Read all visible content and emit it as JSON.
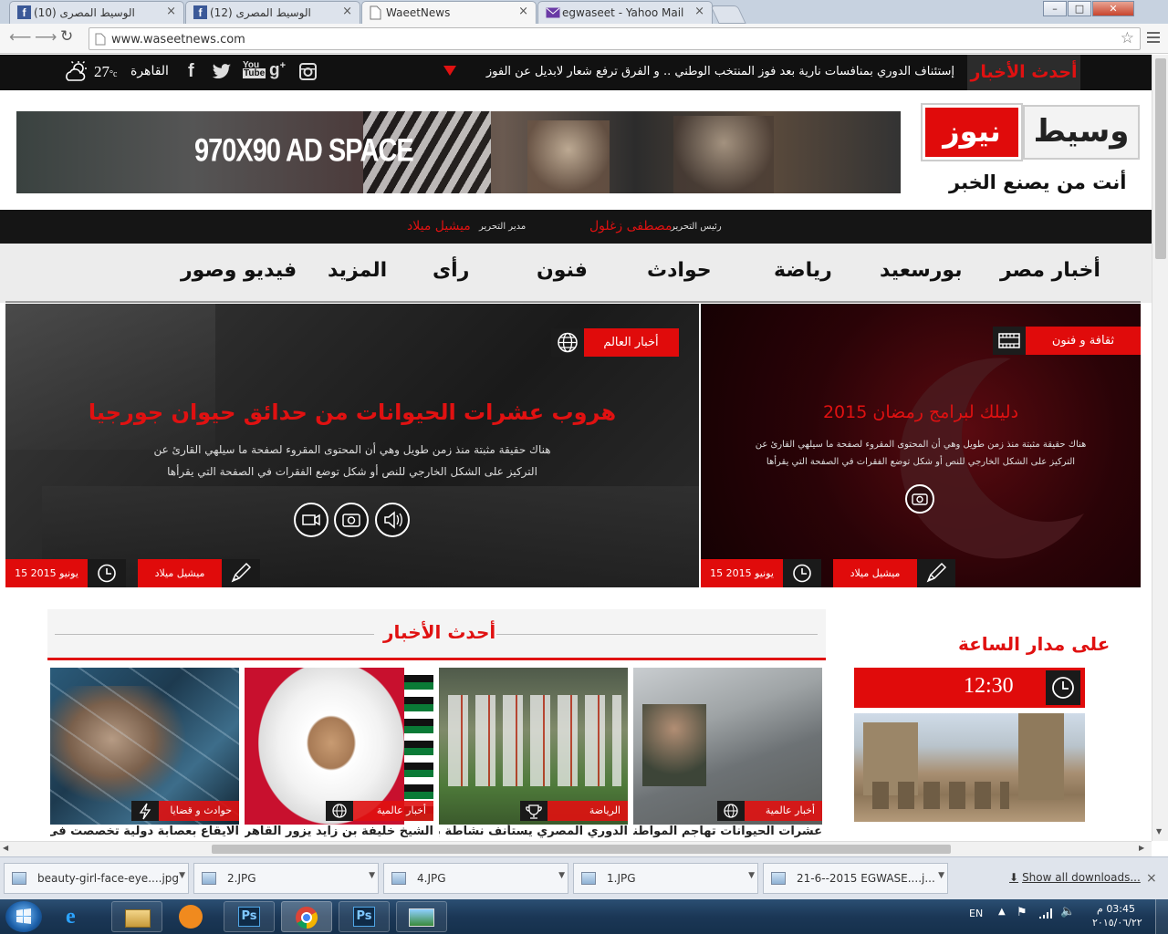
{
  "browser": {
    "tabs": [
      {
        "label": "(10) الوسيط المصرى",
        "close": "×"
      },
      {
        "label": "(12) الوسيط المصرى",
        "close": "×"
      },
      {
        "label": "WaeetNews",
        "close": "×"
      },
      {
        "label": "egwaseet - Yahoo Mail",
        "close": "×"
      }
    ],
    "url": "www.waseetnews.com",
    "window_controls": {
      "min": "–",
      "max": "□",
      "close": "✕"
    }
  },
  "topbar": {
    "latest_label": "أحدث الأخبار",
    "ticker": "إستئناف الدوري بمنافسات نارية بعد فوز المنتخب الوطني .. و الفرق ترفع شعار لابديل عن الفوز",
    "city": "القاهرة",
    "temperature": "27",
    "temp_unit": "°c",
    "social": [
      "f",
      "t",
      "You Tube",
      "g+",
      "instagram"
    ]
  },
  "ad": {
    "text": "970X90 AD SPACE"
  },
  "logo": {
    "word1": "وسيط",
    "word2": "نيوز",
    "tagline": "أنت من يصنع الخبر"
  },
  "staff": {
    "editor_in_chief_label": "رئيس التحرير",
    "editor_in_chief": "مصطفى زغلول",
    "managing_editor_label": "مدير التحرير",
    "managing_editor": "ميشيل ميلاد"
  },
  "menu": [
    "أخبار مصر",
    "بورسعيد",
    "رياضة",
    "حوادث",
    "فنون",
    "رأى",
    "المزيد",
    "فيديو وصور"
  ],
  "hero_left": {
    "category": "أخبار العالم",
    "title": "هروب عشرات الحيوانات من حدائق حيوان جورجيا",
    "text_line1": "هناك حقيقة مثبتة منذ زمن طويل وهي أن المحتوى المقروء لصفحة ما سيلهي القارئ عن",
    "text_line2": "التركيز على الشكل الخارجي للنص أو شكل توضع الفقرات في الصفحة التي يقرأها",
    "author": "ميشيل ميلاد",
    "date": "15 يونيو 2015"
  },
  "hero_right": {
    "category": "ثقافة و فنون",
    "title": "دليلك لبرامج رمضان 2015",
    "text_line1": "هناك حقيقة مثبتة منذ زمن طويل وهي أن المحتوى المقروء لصفحة ما سيلهي القارئ عن",
    "text_line2": "التركيز على الشكل الخارجي للنص أو شكل توضع الفقرات في الصفحة التي يقرأها",
    "author": "ميشيل ميلاد",
    "date": "15 يونيو 2015"
  },
  "latest_news": {
    "title": "أحدث الأخبار",
    "cards": [
      {
        "category": "أخبار عالمية",
        "title": "عشرات الحيوانات تهاجم المواطنين"
      },
      {
        "category": "الرياضة",
        "title": "الدوري المصري يستأنف نشاطة بعد"
      },
      {
        "category": "أخبار عالمية",
        "title": "الشيخ خليفة بن زايد يزور القاهرة فى"
      },
      {
        "category": "حوادث و قضايا",
        "title": "الايقاع بعصابة دولية تخصصت فى"
      }
    ]
  },
  "around_clock": {
    "title": "على مدار الساعة",
    "time": "12:30"
  },
  "downloads": {
    "items": [
      "beauty-girl-face-eye....jpg",
      "2.JPG",
      "4.JPG",
      "1.JPG",
      "21-6--2015  EGWASE....j..."
    ],
    "show_all": "Show all downloads..."
  },
  "taskbar": {
    "lang": "EN",
    "time": "03:45 م",
    "date": "٢٠١٥/٠٦/٢٢"
  },
  "colors": {
    "accent": "#e00b0b",
    "dark": "#111111"
  }
}
